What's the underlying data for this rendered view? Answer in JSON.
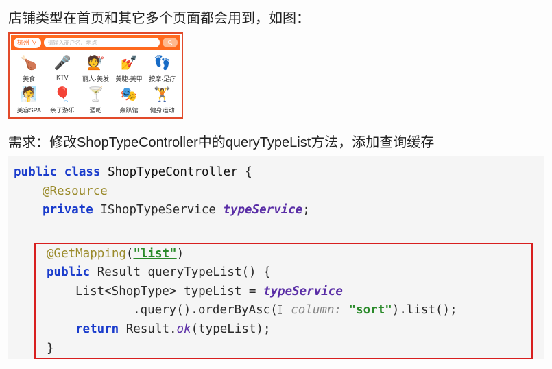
{
  "intro_text": "店铺类型在首页和其它多个页面都会用到，如图：",
  "app": {
    "city": "杭州 ∨",
    "search_placeholder": "请输入商户名、地点",
    "categories": [
      {
        "emoji": "🍗",
        "label": "美食"
      },
      {
        "emoji": "🎤",
        "label": "KTV"
      },
      {
        "emoji": "💇",
        "label": "丽人·美发"
      },
      {
        "emoji": "💅",
        "label": "美睫·美甲"
      },
      {
        "emoji": "👣",
        "label": "按摩·足疗"
      },
      {
        "emoji": "🧖",
        "label": "美容SPA"
      },
      {
        "emoji": "🎈",
        "label": "亲子游乐"
      },
      {
        "emoji": "🍸",
        "label": "酒吧"
      },
      {
        "emoji": "🎭",
        "label": "轰趴馆"
      },
      {
        "emoji": "🏋️",
        "label": "健身运动"
      }
    ]
  },
  "requirement_text": "需求：修改ShopTypeController中的queryTypeList方法，添加查询缓存",
  "code": {
    "kw_public": "public",
    "kw_class": "class",
    "kw_private": "private",
    "kw_return": "return",
    "class_name": "ShopTypeController",
    "brace_open": "{",
    "brace_close": "}",
    "ann_resource": "@Resource",
    "svc_decl_type": "IShopTypeService",
    "svc_decl_name": "typeService",
    "semicolon": ";",
    "ann_getmapping": "@GetMapping",
    "paren_open": "(",
    "paren_close": ")",
    "str_list": "\"list\"",
    "ret_Result": "Result",
    "method_name": "queryTypeList",
    "list_type_open": "List<ShopType>",
    "var_typelist": "typeList",
    "eq": " = ",
    "svc_ref": "typeService",
    "chain_query": ".query()",
    "chain_orderByAsc": ".orderByAsc(",
    "hint_column": " column: ",
    "str_sort": "\"sort\"",
    "chain_list": ").list();",
    "result_ok": "Result.",
    "ok": "ok",
    "ok_args": "(typeList);"
  }
}
